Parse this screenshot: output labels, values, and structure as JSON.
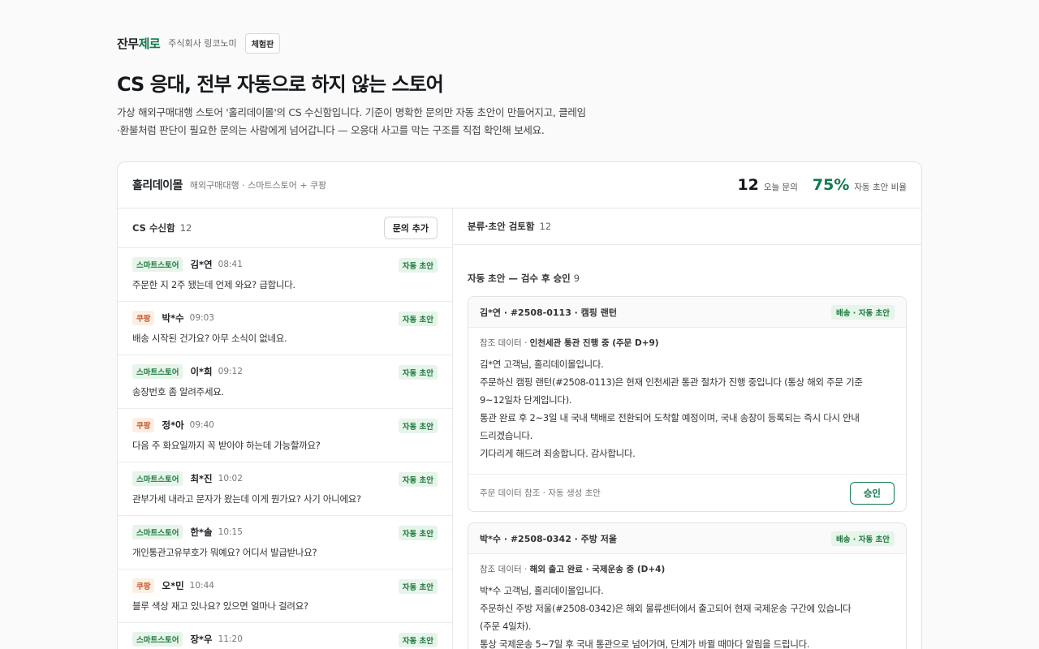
{
  "topbar": {
    "brand_main": "잔무",
    "brand_accent": "제로",
    "company": "주식회사 링코노미",
    "trial": "체험판"
  },
  "hero": {
    "title": "CS 응대, 전부 자동으로 하지 않는 스토어",
    "desc_line1": "가상 해외구매대행 스토어 '홀리데이몰'의 CS 수신함입니다. 기준이 명확한 문의만 자동 초안이 만들어지고, 클레임",
    "desc_line2": "·환불처럼 판단이 필요한 문의는 사람에게 넘어갑니다 — 오응대 사고를 막는 구조를 직접 확인해 보세요."
  },
  "store": {
    "name": "홀리데이몰",
    "sub": "해외구매대행 · 스마트스토어 + 쿠팡",
    "stat_today_num": "12",
    "stat_today_label": "오늘 문의",
    "stat_auto_num": "75%",
    "stat_auto_label": "자동 초안 비율"
  },
  "inbox": {
    "title": "CS 수신함",
    "count": "12",
    "add_label": "문의 추가",
    "items": [
      {
        "channel": "스마트스토어",
        "customer": "김*연",
        "time": "08:41",
        "tag": "자동 초안",
        "message": "주문한 지 2주 됐는데 언제 와요? 급합니다."
      },
      {
        "channel": "쿠팡",
        "customer": "박*수",
        "time": "09:03",
        "tag": "자동 초안",
        "message": "배송 시작된 건가요? 아무 소식이 없네요."
      },
      {
        "channel": "스마트스토어",
        "customer": "이*희",
        "time": "09:12",
        "tag": "자동 초안",
        "message": "송장번호 좀 알려주세요."
      },
      {
        "channel": "쿠팡",
        "customer": "정*아",
        "time": "09:40",
        "tag": "자동 초안",
        "message": "다음 주 화요일까지 꼭 받아야 하는데 가능할까요?"
      },
      {
        "channel": "스마트스토어",
        "customer": "최*진",
        "time": "10:02",
        "tag": "자동 초안",
        "message": "관부가세 내라고 문자가 왔는데 이게 뭔가요? 사기 아니에요?"
      },
      {
        "channel": "스마트스토어",
        "customer": "한*솔",
        "time": "10:15",
        "tag": "자동 초안",
        "message": "개인통관고유부호가 뭐예요? 어디서 발급받나요?"
      },
      {
        "channel": "쿠팡",
        "customer": "오*민",
        "time": "10:44",
        "tag": "자동 초안",
        "message": "블루 색상 재고 있나요? 있으면 얼마나 걸려요?"
      },
      {
        "channel": "스마트스토어",
        "customer": "장*우",
        "time": "11:20",
        "tag": "자동 초안",
        "message": ""
      }
    ]
  },
  "review": {
    "title": "분류·초안 검토함",
    "count": "12",
    "section_label": "자동 초안 — 검수 후 승인",
    "section_count": "9",
    "cards": [
      {
        "title": "김*연 · #2508-0113 · 캠핑 랜턴",
        "category": "배송 · 자동 초안",
        "ref_prefix": "참조 데이터 · ",
        "ref_value": "인천세관 통관 진행 중 (주문 D+9)",
        "lines": [
          "김*연 고객님, 홀리데이몰입니다.",
          "주문하신 캠핑 랜턴(#2508-0113)은 현재 인천세관 통관 절차가 진행 중입니다 (통상 해외 주문 기준",
          "9~12일차 단계입니다).",
          "통관 완료 후 2~3일 내 국내 택배로 전환되어 도착할 예정이며, 국내 송장이 등록되는 즉시 다시 안내",
          "드리겠습니다.",
          "기다리게 해드려 죄송합니다. 감사합니다."
        ],
        "foot": "주문 데이터 참조 · 자동 생성 초안",
        "approve": "승인"
      },
      {
        "title": "박*수 · #2508-0342 · 주방 저울",
        "category": "배송 · 자동 초안",
        "ref_prefix": "참조 데이터 · ",
        "ref_value": "해외 출고 완료 · 국제운송 중 (D+4)",
        "lines": [
          "박*수 고객님, 홀리데이몰입니다.",
          "주문하신 주방 저울(#2508-0342)은 해외 물류센터에서 출고되어 현재 국제운송 구간에 있습니다",
          "(주문 4일차).",
          "통상 국제운송 5~7일 후 국내 통관으로 넘어가며, 단계가 바뀔 때마다 알림을 드립니다."
        ],
        "foot": "",
        "approve": ""
      }
    ]
  }
}
